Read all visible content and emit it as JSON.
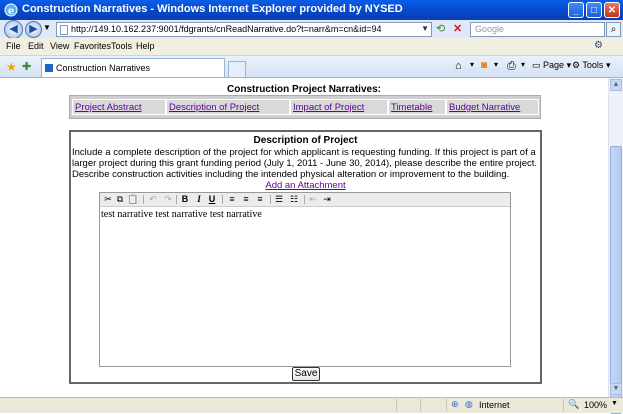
{
  "window": {
    "title": "Construction Narratives - Windows Internet Explorer provided by NYSED"
  },
  "address": {
    "url": "http://149.10.162.237:9001/fdgrants/cnReadNarrative.do?t=narr&m=cn&id=94"
  },
  "search": {
    "placeholder": "Google"
  },
  "menu": {
    "items": [
      "File",
      "Edit",
      "View",
      "Favorites",
      "Tools",
      "Help"
    ]
  },
  "tabs": {
    "active_label": "Construction Narratives"
  },
  "commandbar": {
    "page_label": "Page",
    "tools_label": "Tools"
  },
  "page": {
    "heading": "Construction Project Narratives:",
    "nav_links": [
      "Project Abstract",
      "Description of Project",
      "Impact of Project",
      "Timetable",
      "Budget Narrative"
    ],
    "section_title": "Description of Project",
    "instructions": "Include a complete description of the project for which applicant is requesting funding. If this project is part of a larger project during this grant funding period (July 1, 2011 - June 30, 2014), please describe the entire project. Describe construction activities including the intended physical alteration or improvement to the building.",
    "attach_link": "Add an Attachment",
    "editor_text": "test narrative test narrative test narrative",
    "save_label": "Save"
  },
  "status": {
    "zone": "Internet",
    "zoom": "100%"
  },
  "colors": {
    "titlebar": "#0548c9",
    "link_visited": "#660099",
    "nav_cell_bg": "#d9d9d9"
  }
}
